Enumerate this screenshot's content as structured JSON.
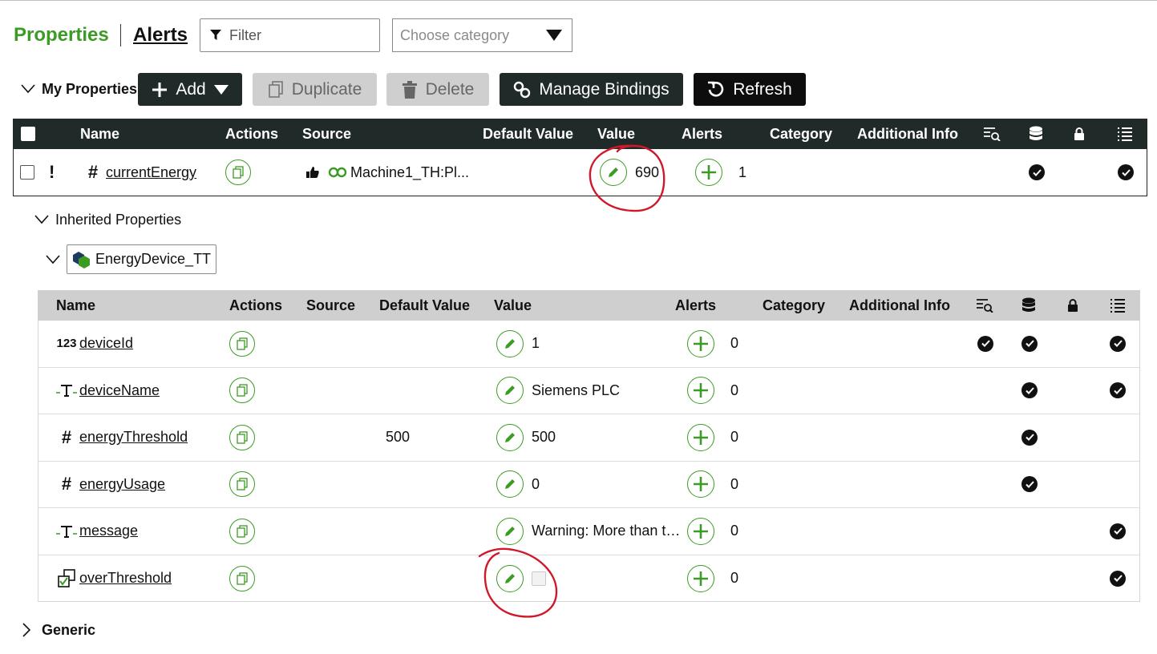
{
  "header": {
    "tab_properties": "Properties",
    "tab_alerts": "Alerts",
    "filter_placeholder": "Filter",
    "category_placeholder": "Choose category"
  },
  "toolbar": {
    "section_label": "My Properties",
    "add_label": "Add",
    "duplicate_label": "Duplicate",
    "delete_label": "Delete",
    "manage_bindings_label": "Manage Bindings",
    "refresh_label": "Refresh"
  },
  "columns": {
    "name": "Name",
    "actions": "Actions",
    "source": "Source",
    "default_value": "Default Value",
    "value": "Value",
    "alerts": "Alerts",
    "category": "Category",
    "additional_info": "Additional Info"
  },
  "my_properties": [
    {
      "name": "currentEnergy",
      "type_icon": "number-hash-icon",
      "flag": "!",
      "source": "Machine1_TH:Pl...",
      "default_value": "",
      "value": "690",
      "alerts": "1",
      "col_logged": false,
      "col_persistent": true,
      "col_readonly": false,
      "col_remote": true
    }
  ],
  "inherited": {
    "section_label": "Inherited Properties",
    "thing_template": "EnergyDevice_TT",
    "rows": [
      {
        "name": "deviceId",
        "type_icon": "integer-icon",
        "type_glyph": "123",
        "default_value": "",
        "value": "1",
        "alerts": "0",
        "logged": true,
        "persistent": true,
        "readonly": false,
        "remote": true
      },
      {
        "name": "deviceName",
        "type_icon": "string-icon",
        "type_glyph": "T",
        "default_value": "",
        "value": "Siemens PLC",
        "alerts": "0",
        "logged": false,
        "persistent": true,
        "readonly": false,
        "remote": true
      },
      {
        "name": "energyThreshold",
        "type_icon": "number-hash-icon",
        "type_glyph": "#",
        "default_value": "500",
        "value": "500",
        "alerts": "0",
        "logged": false,
        "persistent": true,
        "readonly": false,
        "remote": false
      },
      {
        "name": "energyUsage",
        "type_icon": "number-hash-icon",
        "type_glyph": "#",
        "default_value": "",
        "value": "0",
        "alerts": "0",
        "logged": false,
        "persistent": true,
        "readonly": false,
        "remote": false
      },
      {
        "name": "message",
        "type_icon": "string-icon",
        "type_glyph": "T",
        "default_value": "",
        "value": "Warning: More than t…",
        "alerts": "0",
        "logged": false,
        "persistent": false,
        "readonly": false,
        "remote": true
      },
      {
        "name": "overThreshold",
        "type_icon": "boolean-icon",
        "type_glyph": "",
        "default_value": "",
        "value": "",
        "value_is_checkbox": true,
        "alerts": "0",
        "logged": false,
        "persistent": false,
        "readonly": false,
        "remote": true
      }
    ]
  },
  "generic_section_label": "Generic",
  "colors": {
    "accent_green": "#3c9b24",
    "header_dark": "#1f2a29",
    "header_light": "#cfcfcf",
    "annotation_red": "#d0182a"
  }
}
